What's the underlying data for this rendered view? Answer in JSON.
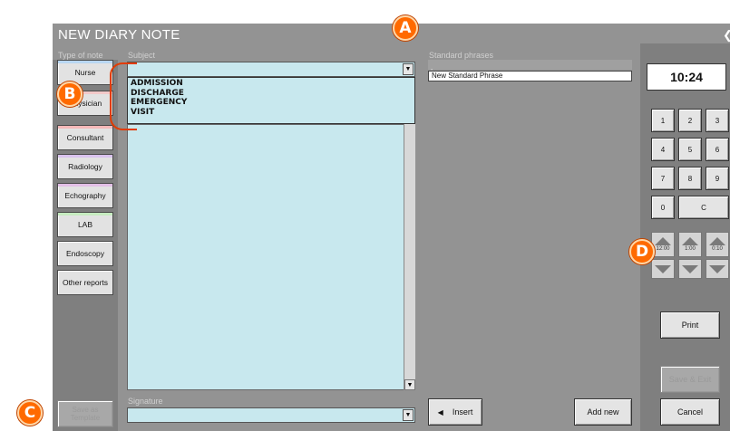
{
  "window": {
    "title": "NEW DIARY NOTE",
    "corner_icon": "chevron-left-icon"
  },
  "labels": {
    "type_of_note": "Type of note",
    "subject": "Subject",
    "standard_phrases": "Standard phrases",
    "signature": "Signature"
  },
  "type_buttons": [
    {
      "label": "Nurse",
      "color": "#b9d7f2"
    },
    {
      "label": "Physician",
      "color": "#f2c9c9"
    },
    {
      "label": "Consultant",
      "color": "#f5b8b8"
    },
    {
      "label": "Radiology",
      "color": "#d9c3ee"
    },
    {
      "label": "Echography",
      "color": "#e2bfe6"
    },
    {
      "label": "LAB",
      "color": "#c6ecc0"
    },
    {
      "label": "Endoscopy",
      "color": "#ffffff"
    },
    {
      "label": "Other reports",
      "color": "#ffffff"
    }
  ],
  "subject": {
    "value": "",
    "dropdown_open": true,
    "options": [
      "ADMISSION",
      "DISCHARGE",
      "EMERGENCY",
      "VISIT"
    ]
  },
  "phrases": {
    "header_item": "-",
    "items": [
      "New Standard Phrase"
    ]
  },
  "buttons": {
    "save_template": "Save as Template",
    "insert": "Insert",
    "add_new": "Add new",
    "print": "Print",
    "save_exit": "Save & Exit",
    "cancel": "Cancel"
  },
  "time": "10:24",
  "keypad": [
    "1",
    "2",
    "3",
    "4",
    "5",
    "6",
    "7",
    "8",
    "9",
    "0",
    "C"
  ],
  "time_steps": [
    "12:00",
    "1:00",
    "0:10"
  ],
  "callouts": [
    "A",
    "B",
    "C",
    "D"
  ],
  "colors": {
    "field_bg": "#c8e8ee",
    "window_bg": "#939393",
    "callout": "#ff6a00"
  }
}
